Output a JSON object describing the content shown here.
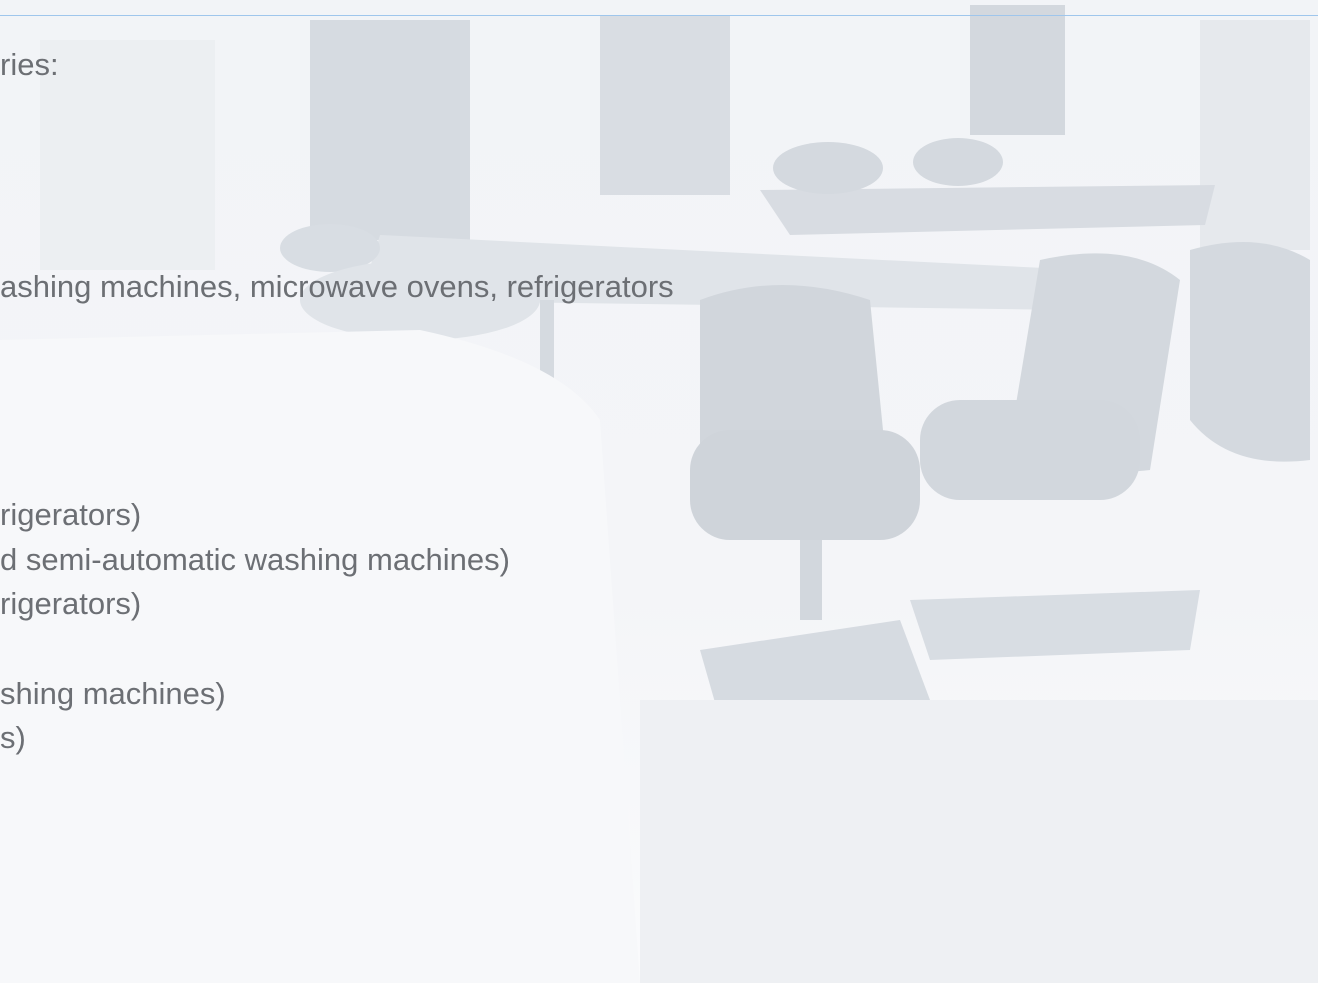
{
  "colors": {
    "text": "#6c6f74",
    "rule": "#9fc6ec",
    "photo_tint": "#d9dde3"
  },
  "lines": [
    "ries:",
    "ashing machines, microwave ovens, refrigerators",
    "rigerators)",
    "d semi-automatic washing machines)",
    "rigerators)",
    "shing machines)",
    "s)"
  ]
}
